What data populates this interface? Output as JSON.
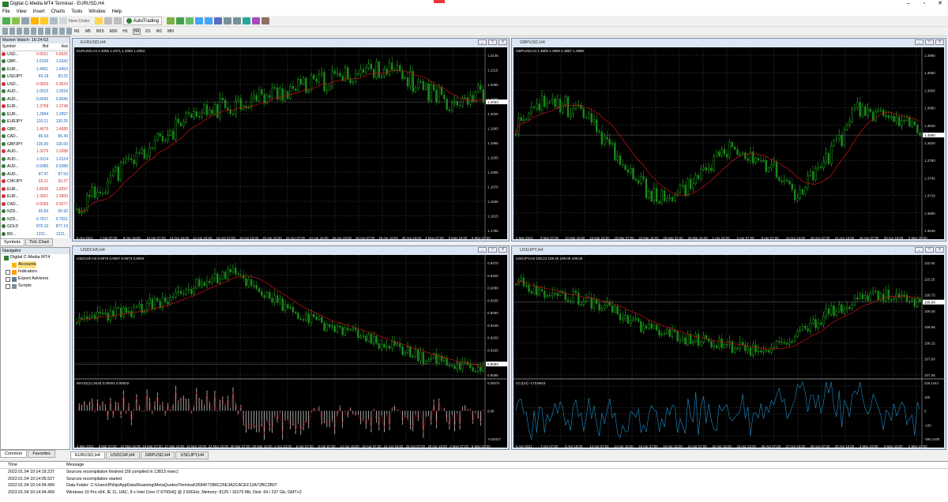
{
  "app": {
    "title": "Digital C-Media MT4 Terminal - EURUSD,H4"
  },
  "menu": [
    "File",
    "View",
    "Insert",
    "Charts",
    "Tools",
    "Window",
    "Help"
  ],
  "toolbar": {
    "new_order": "New Order",
    "autotrading": "AutoTrading"
  },
  "timeframes": [
    "M1",
    "M5",
    "M15",
    "M30",
    "H1",
    "H4",
    "D1",
    "W1",
    "MN"
  ],
  "active_timeframe": "H4",
  "market_watch": {
    "title": "Market Watch: 16:24:53",
    "headers": [
      "Symbol",
      "Bid",
      "Ask"
    ],
    "rows": [
      {
        "s": "USD...",
        "b": "0.8921",
        "a": "0.8925",
        "d": "dn"
      },
      {
        "s": "GBP...",
        "b": "1.6339",
        "a": "1.6342",
        "d": "up"
      },
      {
        "s": "EUR...",
        "b": "1.4451",
        "a": "1.4453",
        "d": "up"
      },
      {
        "s": "USDJPY",
        "b": "83.18",
        "a": "83.22",
        "d": "up"
      },
      {
        "s": "USD...",
        "b": "0.9620",
        "a": "0.9624",
        "d": "dn"
      },
      {
        "s": "AUD...",
        "b": "1.0515",
        "a": "1.0518",
        "d": "up"
      },
      {
        "s": "AUD...",
        "b": "0.8043",
        "a": "0.8046",
        "d": "up"
      },
      {
        "s": "EUR...",
        "b": "1.3758",
        "a": "1.3748",
        "d": "dn"
      },
      {
        "s": "EUR...",
        "b": "1.2894",
        "a": "1.2897",
        "d": "up"
      },
      {
        "s": "EURJPY",
        "b": "120.21",
        "a": "120.25",
        "d": "up"
      },
      {
        "s": "GBP...",
        "b": "1.4675",
        "a": "1.4685",
        "d": "dn"
      },
      {
        "s": "CAD...",
        "b": "86.43",
        "a": "86.49",
        "d": "up"
      },
      {
        "s": "GBPJPY",
        "b": "135.90",
        "a": "136.00",
        "d": "up"
      },
      {
        "s": "AUD...",
        "b": "1.3276",
        "a": "1.3288",
        "d": "dn"
      },
      {
        "s": "AUD...",
        "b": "1.0114",
        "a": "1.0124",
        "d": "up"
      },
      {
        "s": "AUD...",
        "b": "0.9380",
        "a": "0.9388",
        "d": "up"
      },
      {
        "s": "AUD...",
        "b": "87.47",
        "a": "87.53",
        "d": "up"
      },
      {
        "s": "CHFJPY",
        "b": "93.21",
        "a": "93.27",
        "d": "dn"
      },
      {
        "s": "EUR...",
        "b": "1.8245",
        "a": "1.8257",
        "d": "dn"
      },
      {
        "s": "EUR...",
        "b": "1.3901",
        "a": "1.3909",
        "d": "dn"
      },
      {
        "s": "CAD...",
        "b": "0.9269",
        "a": "0.9277",
        "d": "dn"
      },
      {
        "s": "NZD...",
        "b": "65.84",
        "a": "65.92",
        "d": "up"
      },
      {
        "s": "NZD...",
        "b": "0.7917",
        "a": "0.7931",
        "d": "up"
      },
      {
        "s": "GOLD",
        "b": "876.10",
        "a": "877.10",
        "d": "up"
      },
      {
        "s": "BR...",
        "b": "1221...",
        "a": "1221...",
        "d": "up"
      }
    ],
    "tabs": [
      "Symbols",
      "Tick Chart"
    ]
  },
  "navigator": {
    "title": "Navigator",
    "items": [
      "Digital C-Media MT4",
      "Accounts",
      "Indicators",
      "Expert Advisors",
      "Scripts"
    ],
    "tabs": [
      "Common",
      "Favorites"
    ]
  },
  "charts": [
    {
      "title": "EURUSD,H4",
      "info": "EURUSD,H4  1.2065 1.2071 1.2060 1.2063",
      "prices": [
        "1.2145",
        "1.2115",
        "1.2085",
        "1.2055",
        "1.2025",
        "1.1995",
        "1.1965",
        "1.1935",
        "1.1905",
        "1.1875",
        "1.1845",
        "1.1815",
        "1.1785"
      ],
      "current": "1.2063",
      "dates": [
        "5 Apr 2021",
        "7 Apr 07:00",
        "8 Apr 15:00",
        "12 Apr 07:00",
        "13 Apr 15:00",
        "14 Apr 23:00",
        "16 Apr 07:00",
        "19 Apr 15:00",
        "20 Apr 23:00",
        "22 Apr 07:00",
        "23 Apr 15:00",
        "26 Apr 23:00",
        "28 Apr 07:00",
        "29 Apr 15:00",
        "30 Apr 23:00",
        "4 May 07:00",
        "5 May 15:00",
        "6 May 23:00"
      ],
      "seed": 11,
      "trend": [
        0.1,
        0.3,
        0.45,
        0.6,
        0.7,
        0.75,
        0.8,
        0.85,
        0.9,
        0.95,
        0.85,
        0.75,
        0.8
      ]
    },
    {
      "title": "GBPUSD,H4",
      "info": "GBPUSD,H4  1.3900 1.3900 1.3887 1.3890",
      "prices": [
        "1.3990",
        "1.3950",
        "1.3905",
        "1.3880",
        "1.3840",
        "1.3820",
        "1.3780",
        "1.3745",
        "1.3710",
        "1.3680",
        "1.3645"
      ],
      "current": "1.3890",
      "dates": [
        "1 Mar 2021",
        "8 Mar 07:00",
        "10 Mar 15:00",
        "15 Mar 23:00",
        "18 Mar 07:00",
        "22 Mar 15:00",
        "25 Mar 07:00",
        "29 Mar 15:00",
        "1 Apr 23:00",
        "6 Apr 07:00",
        "9 Apr 07:00",
        "13 Apr 23:00",
        "16 Apr 07:00",
        "21 Apr 15:00",
        "26 Apr 07:00",
        "30 Apr 15:00",
        "5 May 15:00"
      ],
      "seed": 23,
      "trend": [
        0.6,
        0.75,
        0.7,
        0.5,
        0.25,
        0.15,
        0.35,
        0.5,
        0.4,
        0.2,
        0.4,
        0.7,
        0.65,
        0.6
      ]
    },
    {
      "title": "USDCHF,H4",
      "info": "USDCHF,H4  0.9076 0.9087 0.9073 0.9083",
      "prices": [
        "0.9470",
        "0.9425",
        "0.9380",
        "0.9335",
        "0.9290",
        "0.9245",
        "0.9200",
        "0.9155",
        "0.9110",
        "0.9065"
      ],
      "current": "0.9083",
      "dates": [
        "3 Mar 2021",
        "8 Mar 07:00",
        "10 Mar 15:00",
        "15 Mar 07:00",
        "17 Mar 15:00",
        "19 Mar 23:00",
        "22 Mar 23:00",
        "25 Mar 07:00",
        "29 Mar 15:00",
        "1 Apr 23:00",
        "6 Apr 07:00",
        "9 Apr 07:00",
        "14 Apr 15:00",
        "19 Apr 07:00",
        "21 Apr 15:00",
        "26 Apr 07:00",
        "29 Apr 15:00",
        "4 May 07:00",
        "5 May 23:00"
      ],
      "ind_info": "MACD(12,26,9)  0.00001  0.00002",
      "ind_scale": [
        "0.00574",
        "0.00",
        "-0.00427"
      ],
      "seed": 37,
      "trend": [
        0.45,
        0.55,
        0.6,
        0.7,
        0.85,
        0.95,
        0.75,
        0.55,
        0.45,
        0.35,
        0.25,
        0.15,
        0.1,
        0.05
      ]
    },
    {
      "title": "USDJPY,H4",
      "info": "USDJPY,H4  109.22 109.25 109.09 109.09",
      "prices": [
        "110.60",
        "110.25",
        "109.75",
        "109.20",
        "108.65",
        "108.15",
        "107.60",
        "107.05"
      ],
      "current": "109.09",
      "dates": [
        "5 Apr 2021",
        "7 Apr 07:00",
        "8 Apr 15:00",
        "13 Apr 07:00",
        "14 Apr 15:00",
        "16 Apr 07:00",
        "19 Apr 15:00",
        "21 Apr 07:00",
        "22 Apr 15:00",
        "23 Apr 23:00",
        "26 Apr 07:00",
        "27 Apr 15:00",
        "29 Apr 07:00",
        "30 Apr 15:00",
        "3 May 23:00",
        "5 May 15:00",
        "6 May 23:00"
      ],
      "ind_info": "CCI(14) -173.8643",
      "ind_scale": [
        "226.1444",
        "100",
        "0",
        "-100",
        "-365.1400"
      ],
      "seed": 53,
      "trend": [
        0.85,
        0.75,
        0.7,
        0.6,
        0.45,
        0.35,
        0.3,
        0.25,
        0.2,
        0.35,
        0.55,
        0.7,
        0.72,
        0.65
      ]
    }
  ],
  "chart_tabs": [
    "EURUSD,H4",
    "USDCHF,H4",
    "GBPUSD,H4",
    "USDJPY,H4"
  ],
  "terminal": {
    "headers": [
      "Time",
      "Message"
    ],
    "rows": [
      {
        "t": "2022.01.04 10:14:19.237",
        "m": "Sources recompilation finished (28 compiled in 13813 msec)"
      },
      {
        "t": "2022.01.04 10:14:05.527",
        "m": "Sources recompilation started"
      },
      {
        "t": "2022.01.04 10:14:04.499",
        "m": "Data Folder: C:\\Users\\Philip\\AppData\\Roaming\\MetaQuotes\\Terminal\\3584F72B6C26E3A2CACEF13A72BC2B07"
      },
      {
        "t": "2022.01.04 10:14:04.499",
        "m": "Windows 10 Pro x64, IE 11, UAC, 8 x Intel Core i7-6700HQ @ 2.60GHz, Memory: 8125 / 16279 Mb, Disk: 64 / 237 Gb, GMT+2"
      }
    ]
  },
  "colors": {
    "bull": "#22c322",
    "bear": "#1a8a1a",
    "ma": "#cc1111",
    "grid": "#6c6c6c",
    "macd": "#c8c8c8",
    "cci": "#1e90c8"
  }
}
